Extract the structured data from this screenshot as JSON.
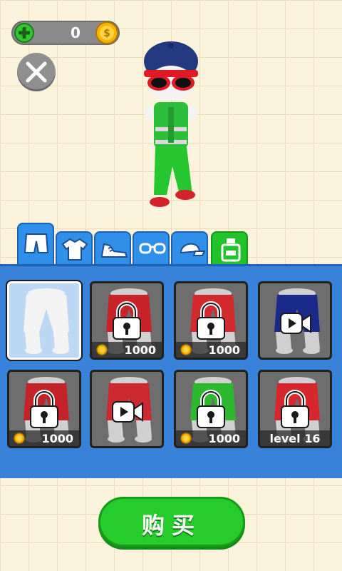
{
  "hud": {
    "coins": "0",
    "plus_icon": "plus-icon",
    "coin_icon": "coin-icon",
    "close_icon": "close-icon"
  },
  "tabs": [
    {
      "name": "shorts",
      "icon": "shorts-icon",
      "active": true
    },
    {
      "name": "shirts",
      "icon": "shirt-icon",
      "active": false
    },
    {
      "name": "shoes",
      "icon": "shoe-icon",
      "active": false
    },
    {
      "name": "glasses",
      "icon": "glasses-icon",
      "active": false
    },
    {
      "name": "hats",
      "icon": "cap-icon",
      "active": false
    },
    {
      "name": "perfume",
      "icon": "perfume-icon",
      "active": false
    }
  ],
  "items": [
    {
      "pants_color": "#f3f3f3",
      "state": "selected",
      "price": ""
    },
    {
      "pants_color": "#c9232a",
      "state": "locked",
      "price": "1000"
    },
    {
      "pants_color": "#d22a2e",
      "state": "locked",
      "price": "1000"
    },
    {
      "pants_color": "#1a2a8a",
      "state": "video",
      "price": ""
    },
    {
      "pants_color": "#c42328",
      "state": "locked",
      "price": "1000"
    },
    {
      "pants_color": "#cc2a30",
      "state": "video",
      "price": ""
    },
    {
      "pants_color": "#2eb82e",
      "state": "locked",
      "price": "1000"
    },
    {
      "pants_color": "#d8272c",
      "state": "locked-level",
      "price": "level 16"
    }
  ],
  "buy_button": {
    "label": "购买"
  },
  "colors": {
    "panel": "#3883d9",
    "tab": "#2f8fe9",
    "buy": "#25cc2b",
    "grid_bg": "#fbf3dc"
  }
}
